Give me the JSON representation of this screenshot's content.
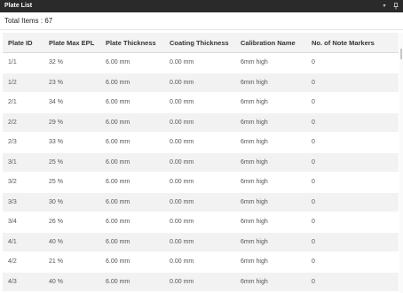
{
  "window": {
    "title": "Plate List",
    "minimize_glyph": "▾",
    "pin_glyph": "ᵖ"
  },
  "summary": {
    "label": "Total Items : 67"
  },
  "table": {
    "headers": [
      "Plate ID",
      "Plate Max EPL",
      "Plate Thickness",
      "Coating Thickness",
      "Calibration Name",
      "No. of Note Markers"
    ],
    "rows": [
      [
        "1/1",
        "32 %",
        "6.00 mm",
        "0.00 mm",
        "6mm high",
        "0"
      ],
      [
        "1/2",
        "23 %",
        "6.00 mm",
        "0.00 mm",
        "6mm high",
        "0"
      ],
      [
        "2/1",
        "34 %",
        "6.00 mm",
        "0.00 mm",
        "6mm high",
        "0"
      ],
      [
        "2/2",
        "29 %",
        "6.00 mm",
        "0.00 mm",
        "6mm high",
        "0"
      ],
      [
        "2/3",
        "33 %",
        "6.00 mm",
        "0.00 mm",
        "6mm high",
        "0"
      ],
      [
        "3/1",
        "25 %",
        "6.00 mm",
        "0.00 mm",
        "6mm high",
        "0"
      ],
      [
        "3/2",
        "25 %",
        "6.00 mm",
        "0.00 mm",
        "6mm high",
        "0"
      ],
      [
        "3/3",
        "30 %",
        "6.00 mm",
        "0.00 mm",
        "6mm high",
        "0"
      ],
      [
        "3/4",
        "26 %",
        "6.00 mm",
        "0.00 mm",
        "6mm high",
        "0"
      ],
      [
        "4/1",
        "40 %",
        "6.00 mm",
        "0.00 mm",
        "6mm high",
        "0"
      ],
      [
        "4/2",
        "21 %",
        "6.00 mm",
        "0.00 mm",
        "6mm high",
        "0"
      ],
      [
        "4/3",
        "40 %",
        "6.00 mm",
        "0.00 mm",
        "6mm high",
        "0"
      ]
    ]
  },
  "colors": {
    "titlebar": "#2a2a2a",
    "header_bg": "#f3f3f3",
    "row_alt": "#f2f2f2"
  }
}
